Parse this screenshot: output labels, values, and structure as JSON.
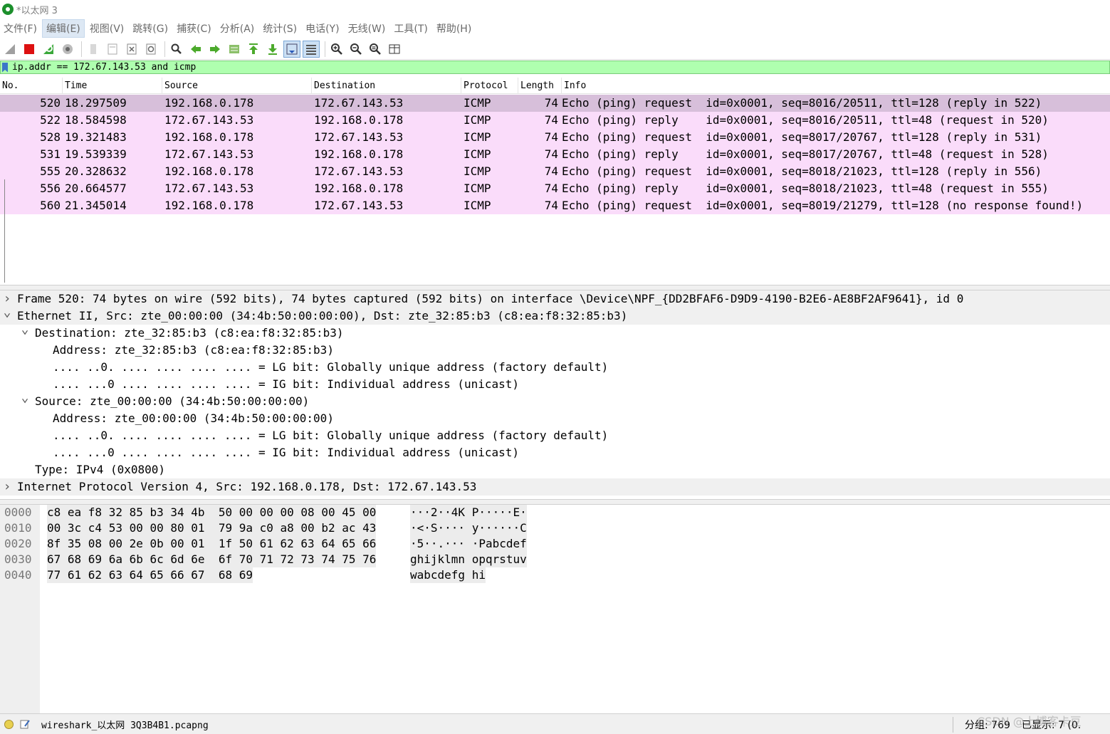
{
  "window": {
    "title": "*以太网 3"
  },
  "menu": [
    "文件(F)",
    "编辑(E)",
    "视图(V)",
    "跳转(G)",
    "捕获(C)",
    "分析(A)",
    "统计(S)",
    "电话(Y)",
    "无线(W)",
    "工具(T)",
    "帮助(H)"
  ],
  "toolbar": {
    "icons": [
      "shark-fin-start-icon",
      "stop-capture-icon",
      "restart-capture-icon",
      "capture-options-icon",
      "open-file-icon",
      "save-file-icon",
      "close-file-icon",
      "reload-file-icon",
      "find-packet-icon",
      "go-back-icon",
      "go-forward-icon",
      "go-to-packet-icon",
      "first-packet-icon",
      "last-packet-icon",
      "auto-scroll-icon",
      "colorize-icon",
      "zoom-in-icon",
      "zoom-out-icon",
      "normal-size-icon",
      "resize-columns-icon"
    ]
  },
  "filter": {
    "value": "ip.addr == 172.67.143.53 and icmp"
  },
  "packet_list": {
    "columns": [
      "No.",
      "Time",
      "Source",
      "Destination",
      "Protocol",
      "Length",
      "Info"
    ],
    "rows": [
      {
        "no": "520",
        "time": "18.297509",
        "src": "192.168.0.178",
        "dst": "172.67.143.53",
        "proto": "ICMP",
        "len": "74",
        "info": "Echo (ping) request  id=0x0001, seq=8016/20511, ttl=128 (reply in 522)"
      },
      {
        "no": "522",
        "time": "18.584598",
        "src": "172.67.143.53",
        "dst": "192.168.0.178",
        "proto": "ICMP",
        "len": "74",
        "info": "Echo (ping) reply    id=0x0001, seq=8016/20511, ttl=48 (request in 520)"
      },
      {
        "no": "528",
        "time": "19.321483",
        "src": "192.168.0.178",
        "dst": "172.67.143.53",
        "proto": "ICMP",
        "len": "74",
        "info": "Echo (ping) request  id=0x0001, seq=8017/20767, ttl=128 (reply in 531)"
      },
      {
        "no": "531",
        "time": "19.539339",
        "src": "172.67.143.53",
        "dst": "192.168.0.178",
        "proto": "ICMP",
        "len": "74",
        "info": "Echo (ping) reply    id=0x0001, seq=8017/20767, ttl=48 (request in 528)"
      },
      {
        "no": "555",
        "time": "20.328632",
        "src": "192.168.0.178",
        "dst": "172.67.143.53",
        "proto": "ICMP",
        "len": "74",
        "info": "Echo (ping) request  id=0x0001, seq=8018/21023, ttl=128 (reply in 556)"
      },
      {
        "no": "556",
        "time": "20.664577",
        "src": "172.67.143.53",
        "dst": "192.168.0.178",
        "proto": "ICMP",
        "len": "74",
        "info": "Echo (ping) reply    id=0x0001, seq=8018/21023, ttl=48 (request in 555)"
      },
      {
        "no": "560",
        "time": "21.345014",
        "src": "192.168.0.178",
        "dst": "172.67.143.53",
        "proto": "ICMP",
        "len": "74",
        "info": "Echo (ping) request  id=0x0001, seq=8019/21279, ttl=128 (no response found!)"
      }
    ]
  },
  "details": [
    {
      "level": 0,
      "arrow": ">",
      "text": "Frame 520: 74 bytes on wire (592 bits), 74 bytes captured (592 bits) on interface \\Device\\NPF_{DD2BFAF6-D9D9-4190-B2E6-AE8BF2AF9641}, id 0"
    },
    {
      "level": 0,
      "arrow": "v",
      "text": "Ethernet II, Src: zte_00:00:00 (34:4b:50:00:00:00), Dst: zte_32:85:b3 (c8:ea:f8:32:85:b3)"
    },
    {
      "level": 1,
      "arrow": "v",
      "text": "Destination: zte_32:85:b3 (c8:ea:f8:32:85:b3)"
    },
    {
      "level": 2,
      "arrow": "",
      "text": "Address: zte_32:85:b3 (c8:ea:f8:32:85:b3)"
    },
    {
      "level": 2,
      "arrow": "",
      "text": ".... ..0. .... .... .... .... = LG bit: Globally unique address (factory default)"
    },
    {
      "level": 2,
      "arrow": "",
      "text": ".... ...0 .... .... .... .... = IG bit: Individual address (unicast)"
    },
    {
      "level": 1,
      "arrow": "v",
      "text": "Source: zte_00:00:00 (34:4b:50:00:00:00)"
    },
    {
      "level": 2,
      "arrow": "",
      "text": "Address: zte_00:00:00 (34:4b:50:00:00:00)"
    },
    {
      "level": 2,
      "arrow": "",
      "text": ".... ..0. .... .... .... .... = LG bit: Globally unique address (factory default)"
    },
    {
      "level": 2,
      "arrow": "",
      "text": ".... ...0 .... .... .... .... = IG bit: Individual address (unicast)"
    },
    {
      "level": 1,
      "arrow": "",
      "text": "Type: IPv4 (0x0800)"
    },
    {
      "level": 0,
      "arrow": ">",
      "text": "Internet Protocol Version 4, Src: 192.168.0.178, Dst: 172.67.143.53"
    }
  ],
  "bytes": [
    {
      "offset": "0000",
      "hex": "c8 ea f8 32 85 b3 34 4b  50 00 00 00 08 00 45 00",
      "ascii": "···2··4K P·····E·"
    },
    {
      "offset": "0010",
      "hex": "00 3c c4 53 00 00 80 01  79 9a c0 a8 00 b2 ac 43",
      "ascii": "·<·S···· y······C"
    },
    {
      "offset": "0020",
      "hex": "8f 35 08 00 2e 0b 00 01  1f 50 61 62 63 64 65 66",
      "ascii": "·5··.··· ·Pabcdef"
    },
    {
      "offset": "0030",
      "hex": "67 68 69 6a 6b 6c 6d 6e  6f 70 71 72 73 74 75 76",
      "ascii": "ghijklmn opqrstuv"
    },
    {
      "offset": "0040",
      "hex": "77 61 62 63 64 65 66 67  68 69",
      "ascii": "wabcdefg hi"
    }
  ],
  "status": {
    "file": "wireshark_以太网 3Q3B4B1.pcapng",
    "packets": "分组: 769",
    "displayed": "已显示: 7 (0.",
    "watermark": "CSDN @上博客卡豆"
  },
  "colors": {
    "row_bg": "#fadcfa",
    "row_selected": "#d7bfda",
    "filter_ok": "#afffaf"
  }
}
